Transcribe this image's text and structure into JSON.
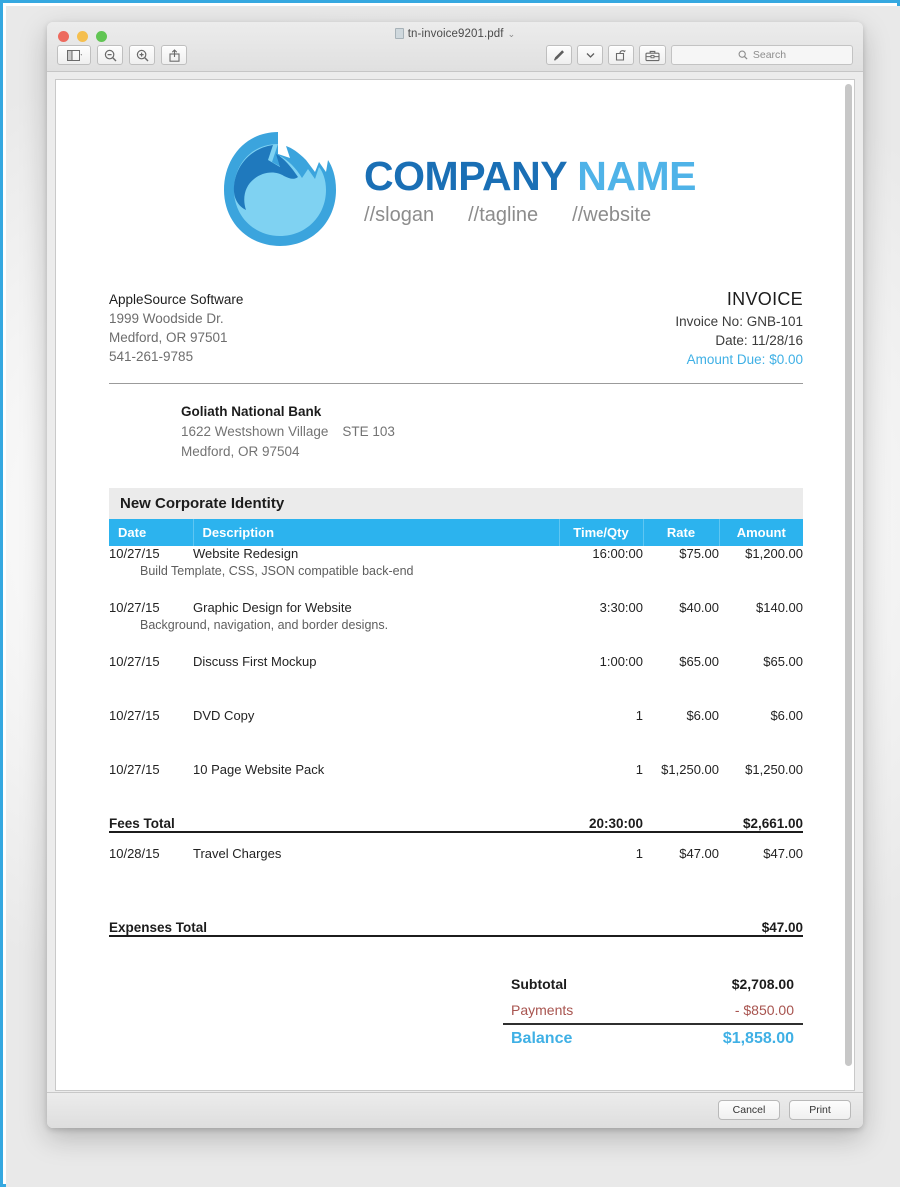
{
  "window": {
    "title": "tn-invoice9201.pdf",
    "title_chevron": "⌄",
    "traffic_lights": [
      "close",
      "minimize",
      "zoom"
    ],
    "toolbar_left": [
      {
        "name": "sidebar-toggle-button",
        "label": ""
      },
      {
        "name": "zoom-out-button",
        "label": ""
      },
      {
        "name": "zoom-in-button",
        "label": ""
      },
      {
        "name": "share-button",
        "label": ""
      }
    ],
    "toolbar_right": [
      {
        "name": "markup-pen-button",
        "label": ""
      },
      {
        "name": "markup-dropdown-button",
        "label": "⌄"
      },
      {
        "name": "rotate-button",
        "label": ""
      },
      {
        "name": "toolkit-button",
        "label": ""
      }
    ],
    "search": {
      "placeholder": "Search",
      "value": ""
    },
    "bottom_buttons": {
      "cancel": "Cancel",
      "print": "Print"
    }
  },
  "invoice": {
    "logo": {
      "company_word1": "COMPANY",
      "company_word2": "NAME",
      "taglines": [
        "//slogan",
        "//tagline",
        "//website"
      ]
    },
    "from": {
      "name": "AppleSource Software",
      "address1": "1999 Woodside Dr.",
      "address2": "Medford, OR 97501",
      "phone": "541-261-9785"
    },
    "header": {
      "title": "INVOICE",
      "invoice_no_label": "Invoice No:",
      "invoice_no": "GNB-101",
      "date_label": "Date:",
      "date": "11/28/16",
      "amount_due_label": "Amount Due:",
      "amount_due": "$0.00"
    },
    "bill_to": {
      "name": "Goliath National Bank",
      "address1": "1622 Westshown Village",
      "suite": "STE 103",
      "address2": "Medford, OR 97504"
    },
    "project_title": "New Corporate Identity",
    "columns": {
      "date": "Date",
      "description": "Description",
      "qty": "Time/Qty",
      "rate": "Rate",
      "amount": "Amount"
    },
    "fee_items": [
      {
        "date": "10/27/15",
        "description": "Website Redesign",
        "note": "Build Template, CSS, JSON compatible back-end",
        "qty": "16:00:00",
        "rate": "$75.00",
        "amount": "$1,200.00"
      },
      {
        "date": "10/27/15",
        "description": "Graphic Design for Website",
        "note": "Background, navigation, and border designs.",
        "qty": "3:30:00",
        "rate": "$40.00",
        "amount": "$140.00"
      },
      {
        "date": "10/27/15",
        "description": "Discuss First Mockup",
        "note": "",
        "qty": "1:00:00",
        "rate": "$65.00",
        "amount": "$65.00"
      },
      {
        "date": "10/27/15",
        "description": "DVD Copy",
        "note": "",
        "qty": "1",
        "rate": "$6.00",
        "amount": "$6.00"
      },
      {
        "date": "10/27/15",
        "description": "10 Page Website Pack",
        "note": "",
        "qty": "1",
        "rate": "$1,250.00",
        "amount": "$1,250.00"
      }
    ],
    "fees_total": {
      "label": "Fees Total",
      "qty": "20:30:00",
      "amount": "$2,661.00"
    },
    "expense_items": [
      {
        "date": "10/28/15",
        "description": "Travel Charges",
        "note": "",
        "qty": "1",
        "rate": "$47.00",
        "amount": "$47.00"
      }
    ],
    "expenses_total": {
      "label": "Expenses Total",
      "qty": "",
      "amount": "$47.00"
    },
    "summary": {
      "subtotal_label": "Subtotal",
      "subtotal_value": "$2,708.00",
      "payments_label": "Payments",
      "payments_value": "-  $850.00",
      "balance_label": "Balance",
      "balance_value": "$1,858.00"
    },
    "colors": {
      "accent_blue": "#3fb0e5",
      "table_header_blue": "#2cb3ee",
      "logo_dark_blue": "#1a6fb5",
      "logo_light_blue": "#4fb3e8",
      "payments_red": "#a8544f",
      "frame_blue": "#35a8e0"
    }
  }
}
